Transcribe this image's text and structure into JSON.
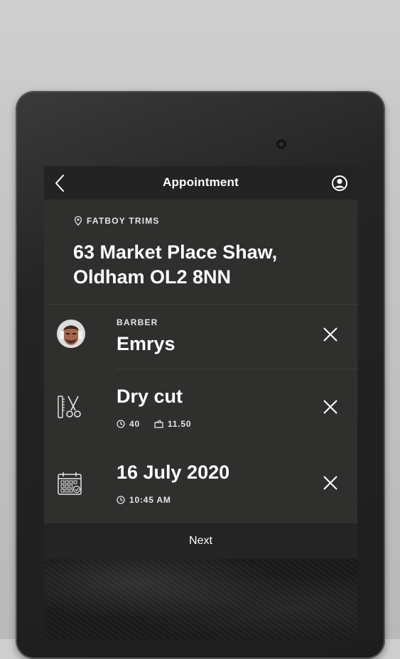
{
  "header": {
    "title": "Appointment"
  },
  "shop": {
    "name": "FATBOY TRIMS",
    "address": "63 Market Place Shaw, Oldham OL2 8NN"
  },
  "barber": {
    "label": "BARBER",
    "name": "Emrys"
  },
  "service": {
    "name": "Dry cut",
    "duration": "40",
    "price": "11.50"
  },
  "schedule": {
    "date": "16 July 2020",
    "time": "10:45 AM"
  },
  "footer": {
    "next_label": "Next"
  },
  "icons": {
    "back": "chevron-left-icon",
    "profile": "user-circle-icon",
    "location": "map-pin-icon",
    "service": "scissors-comb-icon",
    "calendar": "calendar-icon",
    "clock": "clock-icon",
    "price": "wallet-icon",
    "remove": "close-icon"
  }
}
